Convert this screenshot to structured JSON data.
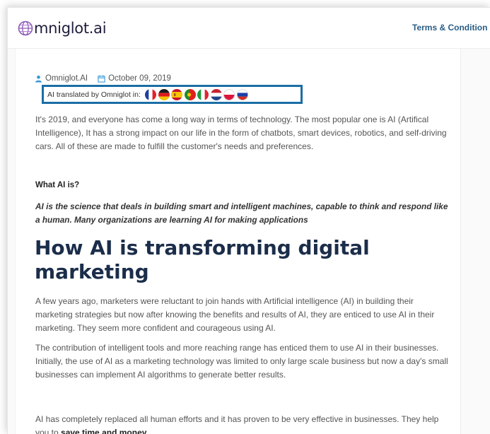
{
  "header": {
    "logo_text": "mniglot.ai",
    "nav_terms": "Terms & Condition"
  },
  "meta": {
    "author": "Omniglot.AI",
    "date": "October 09, 2019"
  },
  "translation": {
    "label": "AI translated by Omniglot in:",
    "flags": [
      "france-flag",
      "germany-flag",
      "spain-flag",
      "portugal-flag",
      "italy-flag",
      "netherlands-flag",
      "poland-flag",
      "russia-flag"
    ]
  },
  "article": {
    "intro": "It's 2019, and everyone has come a long way in terms of technology. The most popular one is AI (Artifical Intelligence), It has a strong impact on our life in the form of chatbots, smart devices, robotics, and self-driving cars. All of these are made to fulfill the customer's needs and preferences.",
    "what_heading": "What AI is?",
    "definition": "AI is the science that deals in building smart and intelligent machines, capable to think and respond like a human. Many organizations are learning AI for making applications",
    "heading": "How AI is transforming digital marketing",
    "para2": "A few years ago, marketers were reluctant to join hands with Artificial intelligence (AI) in building their marketing strategies but now after knowing the benefits and results of AI, they are enticed to use AI in their marketing. They seem more confident and courageous using AI.",
    "para3": "The contribution of intelligent tools and more reaching range has enticed them to use AI in their businesses. Initially, the use of AI as a marketing technology was limited to only large scale business but now a day's small businesses can implement AI algorithms to generate better results.",
    "para4_start": "AI has completely replaced all human efforts and it has proven to be very effective in businesses. They help you to ",
    "para4_bold": "save time and money",
    "para4_end": "."
  },
  "colors": {
    "accent": "#1a6ea5",
    "heading": "#1b2d4a",
    "nav": "#2a5d84"
  }
}
